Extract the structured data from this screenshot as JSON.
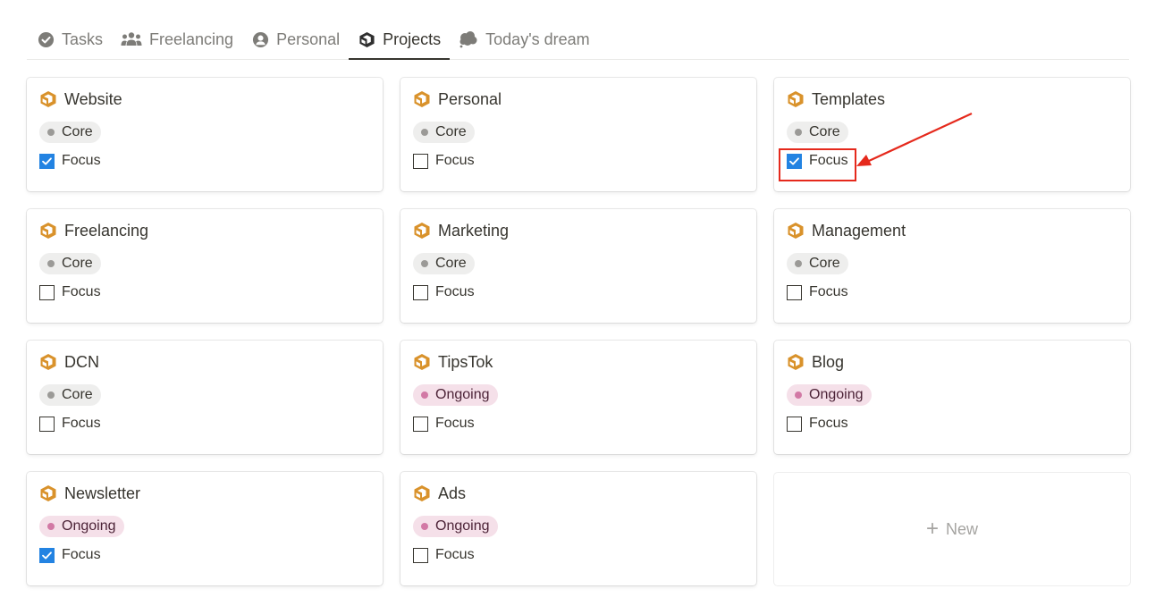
{
  "tabs": [
    {
      "label": "Tasks",
      "icon": "check-circle-icon",
      "active": false
    },
    {
      "label": "Freelancing",
      "icon": "people-icon",
      "active": false
    },
    {
      "label": "Personal",
      "icon": "user-circle-icon",
      "active": false
    },
    {
      "label": "Projects",
      "icon": "box-icon",
      "active": true
    },
    {
      "label": "Today's dream",
      "icon": "cloud-icon",
      "active": false
    }
  ],
  "colors": {
    "project_icon": "#d9922b",
    "checkbox_checked": "#2383e2",
    "annotation": "#e5291c"
  },
  "projects": [
    {
      "title": "Website",
      "status": "Core",
      "status_type": "core",
      "focus_label": "Focus",
      "focus": true
    },
    {
      "title": "Personal",
      "status": "Core",
      "status_type": "core",
      "focus_label": "Focus",
      "focus": false
    },
    {
      "title": "Templates",
      "status": "Core",
      "status_type": "core",
      "focus_label": "Focus",
      "focus": true
    },
    {
      "title": "Freelancing",
      "status": "Core",
      "status_type": "core",
      "focus_label": "Focus",
      "focus": false
    },
    {
      "title": "Marketing",
      "status": "Core",
      "status_type": "core",
      "focus_label": "Focus",
      "focus": false
    },
    {
      "title": "Management",
      "status": "Core",
      "status_type": "core",
      "focus_label": "Focus",
      "focus": false
    },
    {
      "title": "DCN",
      "status": "Core",
      "status_type": "core",
      "focus_label": "Focus",
      "focus": false
    },
    {
      "title": "TipsTok",
      "status": "Ongoing",
      "status_type": "ongoing",
      "focus_label": "Focus",
      "focus": false
    },
    {
      "title": "Blog",
      "status": "Ongoing",
      "status_type": "ongoing",
      "focus_label": "Focus",
      "focus": false
    },
    {
      "title": "Newsletter",
      "status": "Ongoing",
      "status_type": "ongoing",
      "focus_label": "Focus",
      "focus": true
    },
    {
      "title": "Ads",
      "status": "Ongoing",
      "status_type": "ongoing",
      "focus_label": "Focus",
      "focus": false
    }
  ],
  "new_button": {
    "icon": "+",
    "label": "New"
  }
}
